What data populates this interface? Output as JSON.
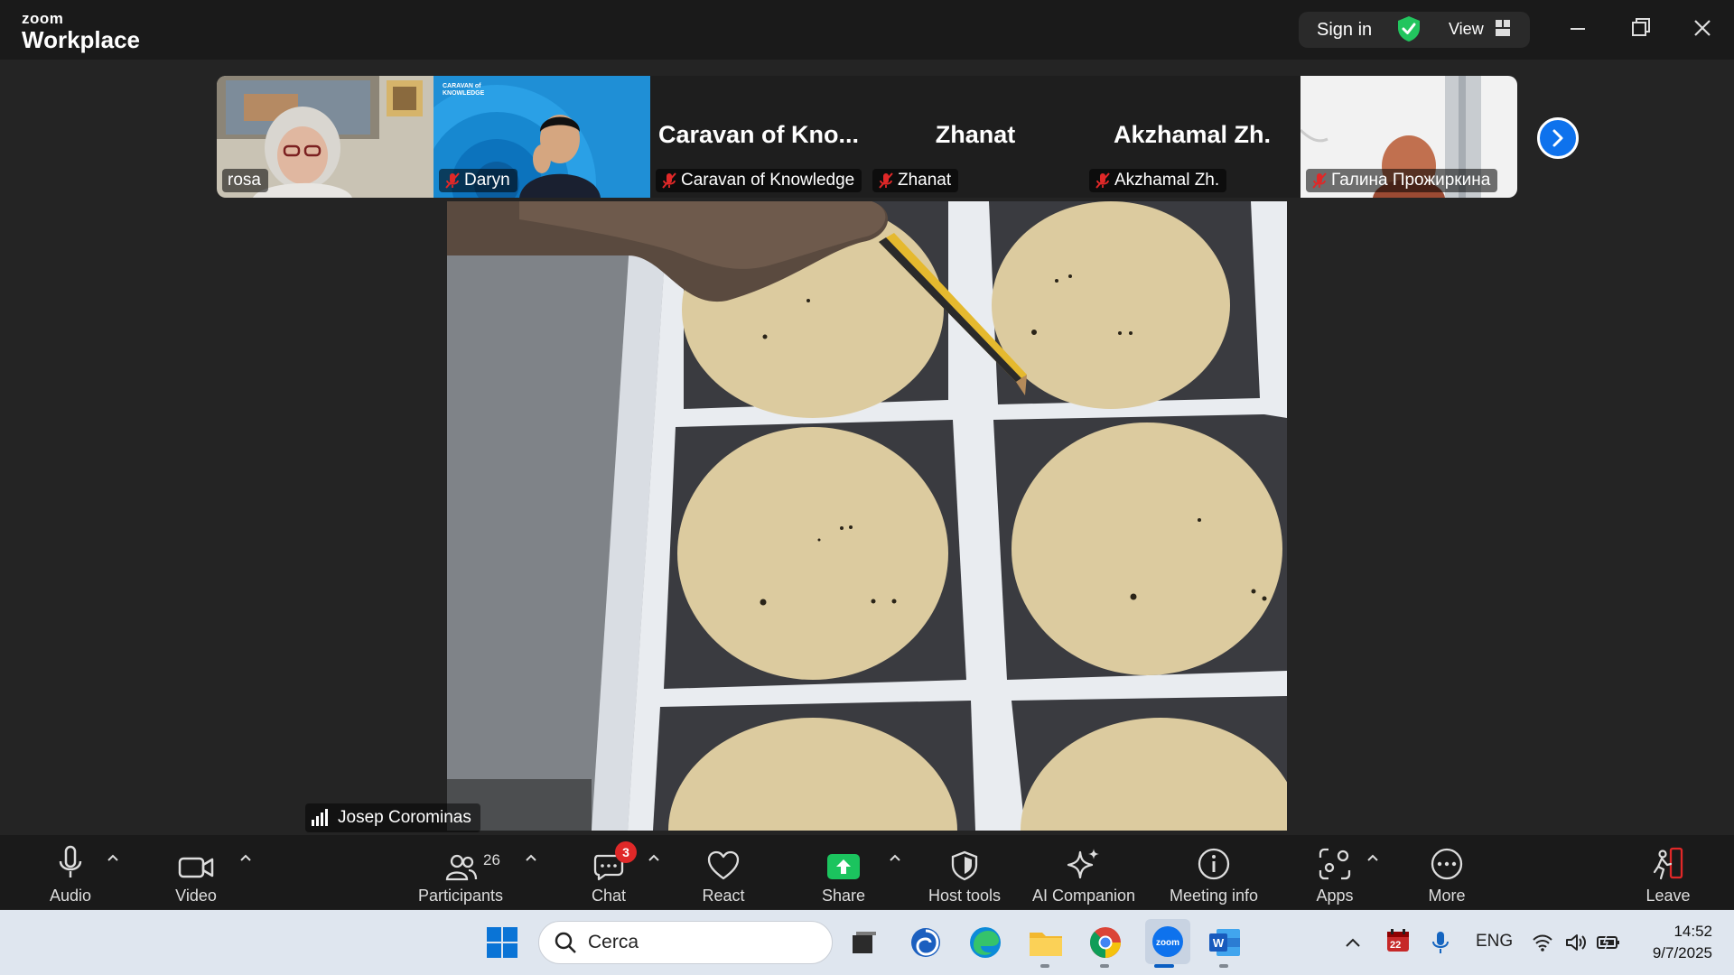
{
  "app": {
    "logo_small": "zoom",
    "logo_large": "Workplace",
    "sign_in": "Sign in",
    "view": "View"
  },
  "participants_strip": [
    {
      "name": "rosa",
      "muted": false,
      "has_video": true
    },
    {
      "name": "Daryn",
      "muted": true,
      "has_video": true,
      "banner_text": "CARAVAN of KNOWLEDGE"
    },
    {
      "name": "Caravan of Knowledge",
      "display": "Caravan of Kno...",
      "muted": true,
      "has_video": false
    },
    {
      "name": "Zhanat",
      "display": "Zhanat",
      "muted": true,
      "has_video": false
    },
    {
      "name": "Akzhamal Zh.",
      "display": "Akzhamal Zh.",
      "muted": true,
      "has_video": false
    },
    {
      "name": "Галина Прожиркина",
      "muted": true,
      "has_video": true
    }
  ],
  "main_video": {
    "speaker": "Josep Corominas"
  },
  "toolbar": {
    "audio": "Audio",
    "video": "Video",
    "participants": "Participants",
    "participants_count": "26",
    "chat": "Chat",
    "chat_badge": "3",
    "react": "React",
    "share": "Share",
    "host_tools": "Host tools",
    "ai_companion": "AI Companion",
    "meeting_info": "Meeting info",
    "apps": "Apps",
    "more": "More",
    "leave": "Leave"
  },
  "taskbar": {
    "search_placeholder": "Cerca",
    "language": "ENG",
    "time": "14:52",
    "date": "9/7/2025",
    "calendar_badge": "22"
  },
  "colors": {
    "accent_blue": "#0e72ed",
    "share_green": "#1bc45e",
    "muted_red": "#e02828",
    "shield_green": "#22c55e"
  }
}
